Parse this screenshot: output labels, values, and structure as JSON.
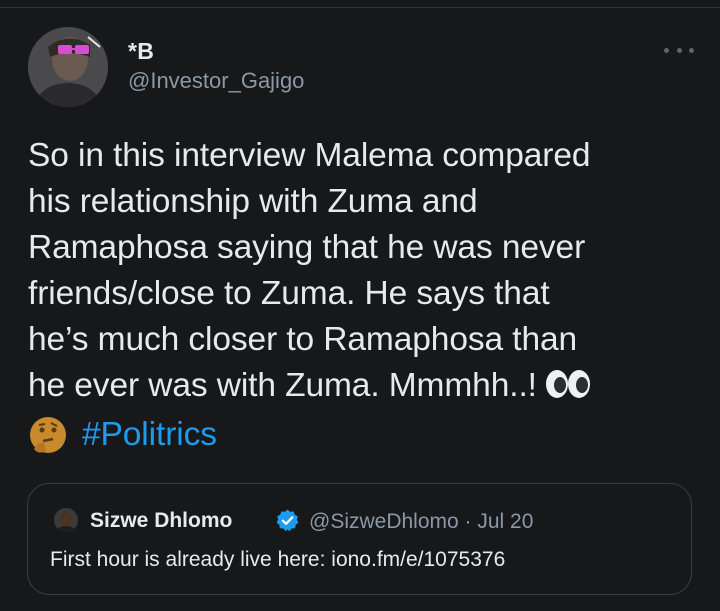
{
  "tweet": {
    "display_name": "*B",
    "handle": "@Investor_Gajigo",
    "body_lines": [
      "So in this interview Malema compared",
      "his relationship with Zuma and",
      "Ramaphosa saying that he was never",
      "friends/close to Zuma. He says that",
      "he’s much closer to Ramaphosa than",
      "he ever was with Zuma. Mmmhh..!"
    ],
    "hashtag": "#Politrics",
    "emojis": [
      "eyes-emoji",
      "thinking-face-emoji"
    ]
  },
  "quote": {
    "display_name": "Sizwe Dhlomo",
    "verified": true,
    "handle_date": "@SizweDhlomo · Jul 20",
    "text": "First hour is already live here: iono.fm/e/1075376"
  },
  "colors": {
    "background": "#16181a",
    "text": "#e7e9ea",
    "secondary": "#8b98a5",
    "link": "#1d9bf0",
    "verified": "#1d9bf0"
  }
}
